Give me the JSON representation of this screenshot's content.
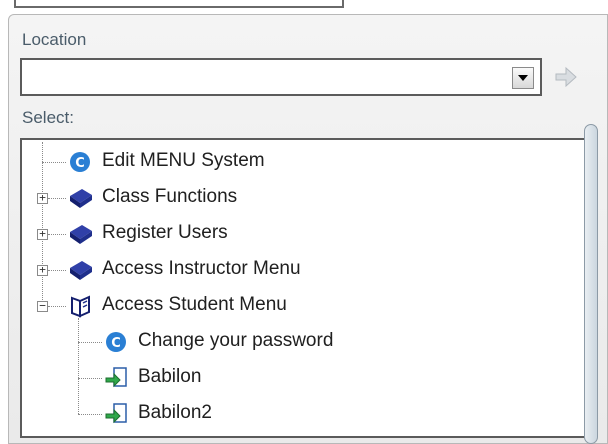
{
  "location": {
    "label": "Location",
    "value": ""
  },
  "select_label": "Select:",
  "tree": {
    "items": [
      {
        "label": "Edit MENU System",
        "icon": "cs-logo-icon",
        "level": 0,
        "expander": "none"
      },
      {
        "label": "Class Functions",
        "icon": "book-icon",
        "level": 0,
        "expander": "+"
      },
      {
        "label": "Register Users",
        "icon": "book-icon",
        "level": 0,
        "expander": "+"
      },
      {
        "label": "Access Instructor Menu",
        "icon": "book-icon",
        "level": 0,
        "expander": "+"
      },
      {
        "label": "Access Student Menu",
        "icon": "open-book-icon",
        "level": 0,
        "expander": "-"
      },
      {
        "label": "Change your password",
        "icon": "cs-logo-icon",
        "level": 1,
        "expander": "none"
      },
      {
        "label": "Babilon",
        "icon": "link-arrow-icon",
        "level": 1,
        "expander": "none"
      },
      {
        "label": "Babilon2",
        "icon": "link-arrow-icon",
        "level": 1,
        "expander": "none"
      }
    ]
  },
  "colors": {
    "book_blue": "#1f2f8c",
    "cs_logo_blue": "#2a7fd4",
    "link_green": "#2fa84a",
    "label_text": "#4a5c6a"
  }
}
